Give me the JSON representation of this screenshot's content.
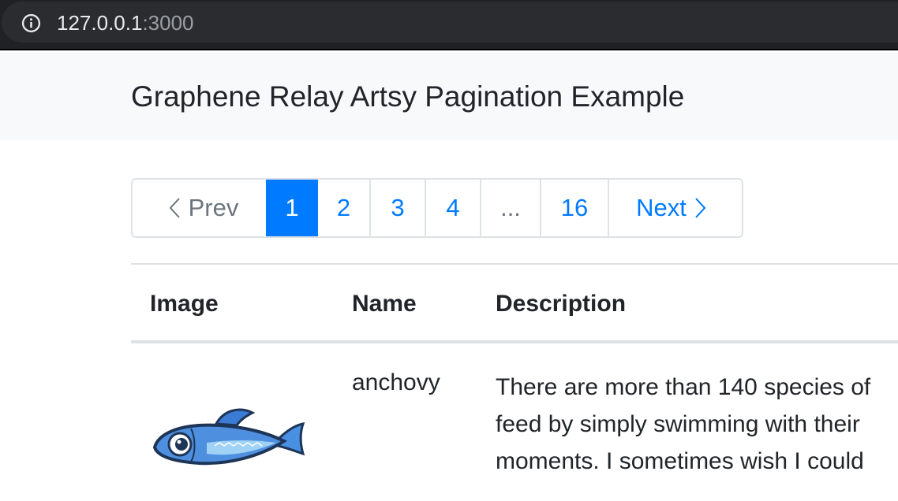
{
  "browser": {
    "url_host": "127.0.0.1",
    "url_port": ":3000",
    "icon": "info-icon"
  },
  "navbar": {
    "brand": "Graphene Relay Artsy Pagination Example"
  },
  "pagination": {
    "prev_label": "Prev",
    "pages": [
      "1",
      "2",
      "3",
      "4"
    ],
    "ellipsis": "...",
    "last_page": "16",
    "next_label": "Next",
    "active_page": "1",
    "colors": {
      "active_bg": "#007bff",
      "link": "#007bff",
      "disabled": "#6c757d"
    }
  },
  "table": {
    "headers": [
      "Image",
      "Name",
      "Description"
    ],
    "rows": [
      {
        "image_icon": "anchovy-fish-image",
        "name": "anchovy",
        "description_lines": [
          "There are more than 140 species of",
          "feed by simply swimming with their",
          "moments. I sometimes wish I could"
        ]
      }
    ]
  }
}
